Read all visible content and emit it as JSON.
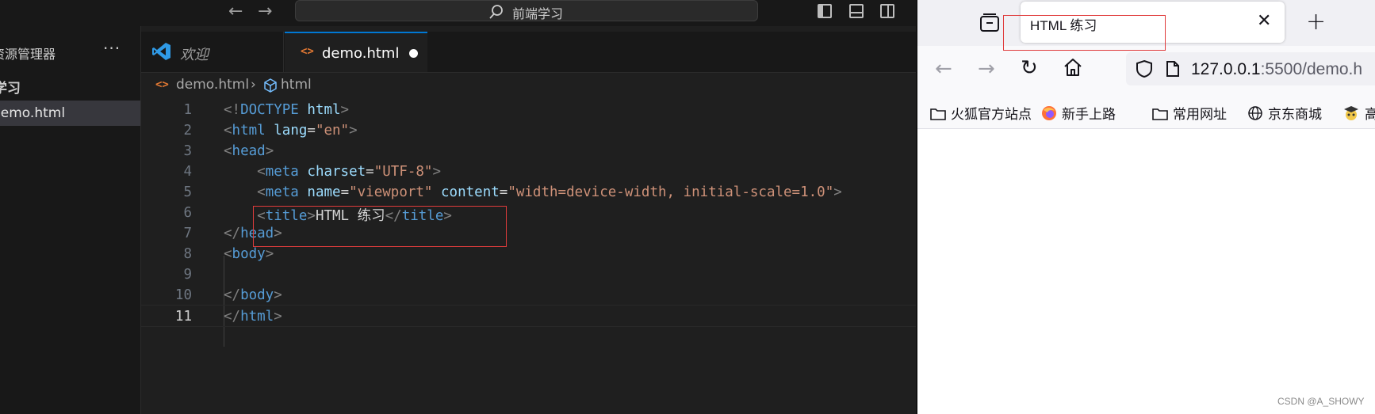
{
  "vscode": {
    "command_center": "前端学习",
    "sidebar": {
      "title": "资源管理器",
      "folder": "学习",
      "file": "demo.html"
    },
    "tabs": [
      {
        "label": "欢迎"
      },
      {
        "label": "demo.html"
      }
    ],
    "breadcrumb": [
      "demo.html",
      "html"
    ],
    "active_line": 11
  },
  "browser": {
    "tab_title": "HTML 练习",
    "url_host": "127.0.0.1",
    "url_rest": ":5500/demo.h",
    "bookmarks": [
      "火狐官方站点",
      "新手上路",
      "常用网址",
      "京东商城",
      "高"
    ]
  },
  "watermark": "CSDN @A_SHOWY",
  "colors": {
    "accent": "#0078d4",
    "highlight_box": "#e03c3c",
    "tag": "#569cd6",
    "attribute": "#9cdcfe",
    "string": "#ce9178"
  }
}
